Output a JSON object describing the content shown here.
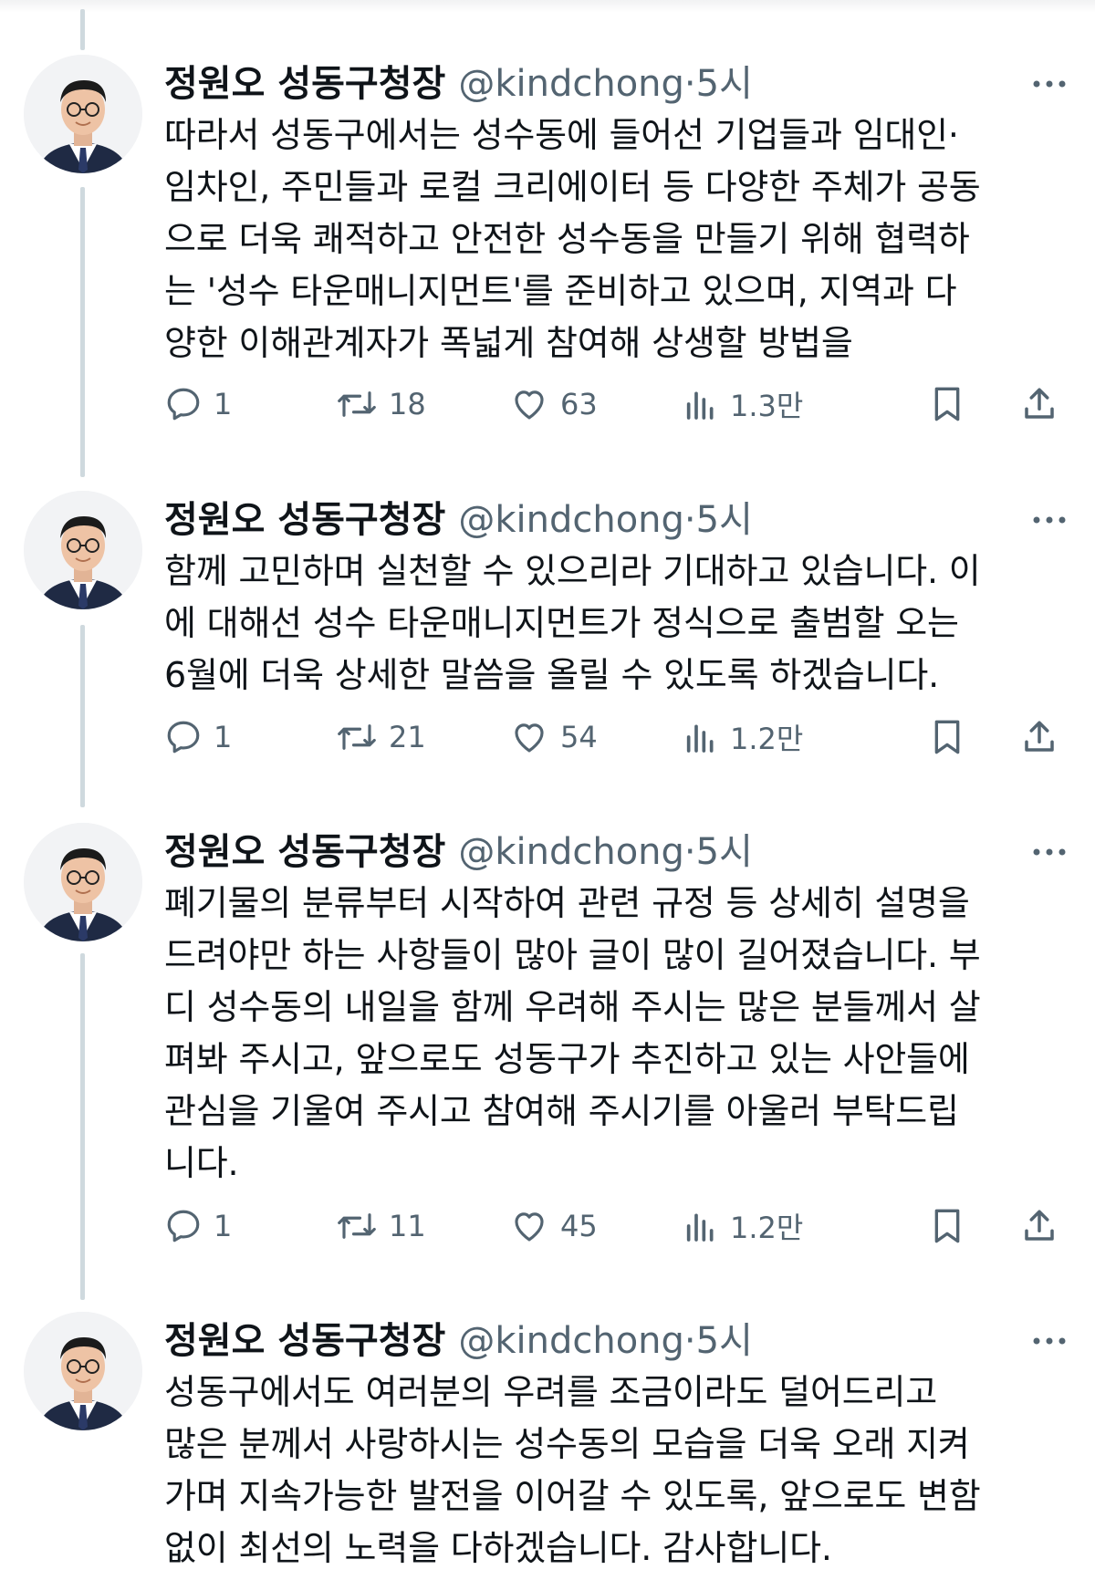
{
  "colors": {
    "text": "#0f1419",
    "secondary": "#536471",
    "thread_line": "#cfd9de"
  },
  "icons": {
    "reply": "reply-icon",
    "retweet": "retweet-icon",
    "like": "heart-icon",
    "views": "views-icon",
    "bookmark": "bookmark-icon",
    "share": "share-icon",
    "more": "more-icon"
  },
  "tweets": [
    {
      "author": "정원오 성동구청장",
      "handle": "@kindchong",
      "separator": "·",
      "time": "5시",
      "text": "따라서 성동구에서는 성수동에 들어선 기업들과 임대인·\n임차인, 주민들과 로컬 크리에이터 등 다양한 주체가 공동\n으로 더욱 쾌적하고 안전한 성수동을 만들기 위해 협력하\n는 '성수 타운매니지먼트'를 준비하고 있으며, 지역과 다\n양한 이해관계자가 폭넓게 참여해 상생할 방법을",
      "replies": "1",
      "retweets": "18",
      "likes": "63",
      "views": "1.3만"
    },
    {
      "author": "정원오 성동구청장",
      "handle": "@kindchong",
      "separator": "·",
      "time": "5시",
      "text": "함께 고민하며 실천할 수 있으리라 기대하고 있습니다. 이\n에 대해선 성수 타운매니지먼트가 정식으로 출범할 오는\n6월에 더욱 상세한 말씀을 올릴 수 있도록 하겠습니다.",
      "replies": "1",
      "retweets": "21",
      "likes": "54",
      "views": "1.2만"
    },
    {
      "author": "정원오 성동구청장",
      "handle": "@kindchong",
      "separator": "·",
      "time": "5시",
      "text": "폐기물의 분류부터 시작하여 관련 규정 등 상세히 설명을\n드려야만 하는 사항들이 많아 글이 많이 길어졌습니다. 부\n디 성수동의 내일을 함께 우려해 주시는 많은 분들께서 살\n펴봐 주시고, 앞으로도 성동구가 추진하고 있는 사안들에\n관심을 기울여 주시고 참여해 주시기를 아울러 부탁드립\n니다.",
      "replies": "1",
      "retweets": "11",
      "likes": "45",
      "views": "1.2만"
    },
    {
      "author": "정원오 성동구청장",
      "handle": "@kindchong",
      "separator": "·",
      "time": "5시",
      "text": "성동구에서도 여러분의 우려를 조금이라도 덜어드리고\n많은 분께서 사랑하시는 성수동의 모습을 더욱 오래 지켜\n가며 지속가능한 발전을 이어갈 수 있도록, 앞으로도 변함\n없이 최선의 노력을 다하겠습니다. 감사합니다.",
      "replies": null,
      "retweets": null,
      "likes": null,
      "views": null
    }
  ]
}
